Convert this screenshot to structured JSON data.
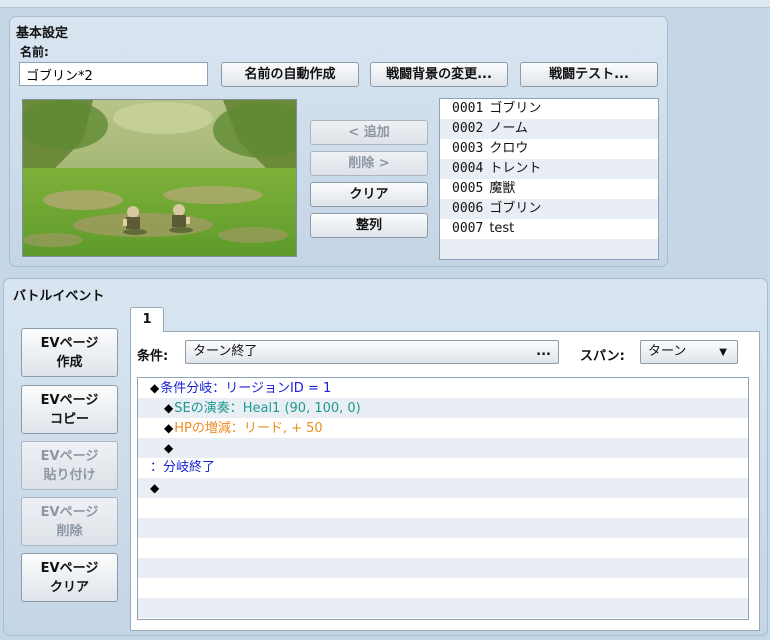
{
  "basic": {
    "title": "基本設定",
    "name_label": "名前:",
    "name_value": "ゴブリン*2",
    "auto_name_button": "名前の自動作成",
    "change_bg_button": "戦闘背景の変更...",
    "battle_test_button": "戦闘テスト...",
    "add_button": "< 追加",
    "remove_button": "削除 >",
    "clear_button": "クリア",
    "sort_button": "整列",
    "enemies": [
      {
        "id": "0001",
        "name": "ゴブリン"
      },
      {
        "id": "0002",
        "name": "ノーム"
      },
      {
        "id": "0003",
        "name": "クロウ"
      },
      {
        "id": "0004",
        "name": "トレント"
      },
      {
        "id": "0005",
        "name": "魔獣"
      },
      {
        "id": "0006",
        "name": "ゴブリン"
      },
      {
        "id": "0007",
        "name": "test"
      }
    ]
  },
  "battle_event": {
    "title": "バトルイベント",
    "page_buttons": {
      "create": "EVページ\n作成",
      "copy": "EVページ\nコピー",
      "paste": "EVページ\n貼り付け",
      "delete": "EVページ\n削除",
      "clear": "EVページ\nクリア"
    },
    "tab_label": "1",
    "condition_label": "条件:",
    "condition_value": "ターン終了",
    "condition_ellipsis": "...",
    "span_label": "スパン:",
    "span_value": "ターン",
    "commands": [
      {
        "indent": 0,
        "diamond": true,
        "text": "条件分岐：リージョンID = 1",
        "color": "#1a22d6"
      },
      {
        "indent": 1,
        "diamond": true,
        "text": "SEの演奏：Heal1 (90, 100, 0)",
        "color": "#1f9a8e"
      },
      {
        "indent": 1,
        "diamond": true,
        "text": "HPの増減：リード, + 50",
        "color": "#ef8d20"
      },
      {
        "indent": 1,
        "diamond": true,
        "text": "",
        "color": "#000000"
      },
      {
        "indent": 0,
        "diamond": false,
        "text": "：分岐終了",
        "color": "#1a22d6"
      },
      {
        "indent": 0,
        "diamond": true,
        "text": "",
        "color": "#000000"
      }
    ]
  },
  "colors": {
    "accent_blue": "#1a22d6",
    "teal": "#1f9a8e",
    "orange": "#ef8d20"
  }
}
